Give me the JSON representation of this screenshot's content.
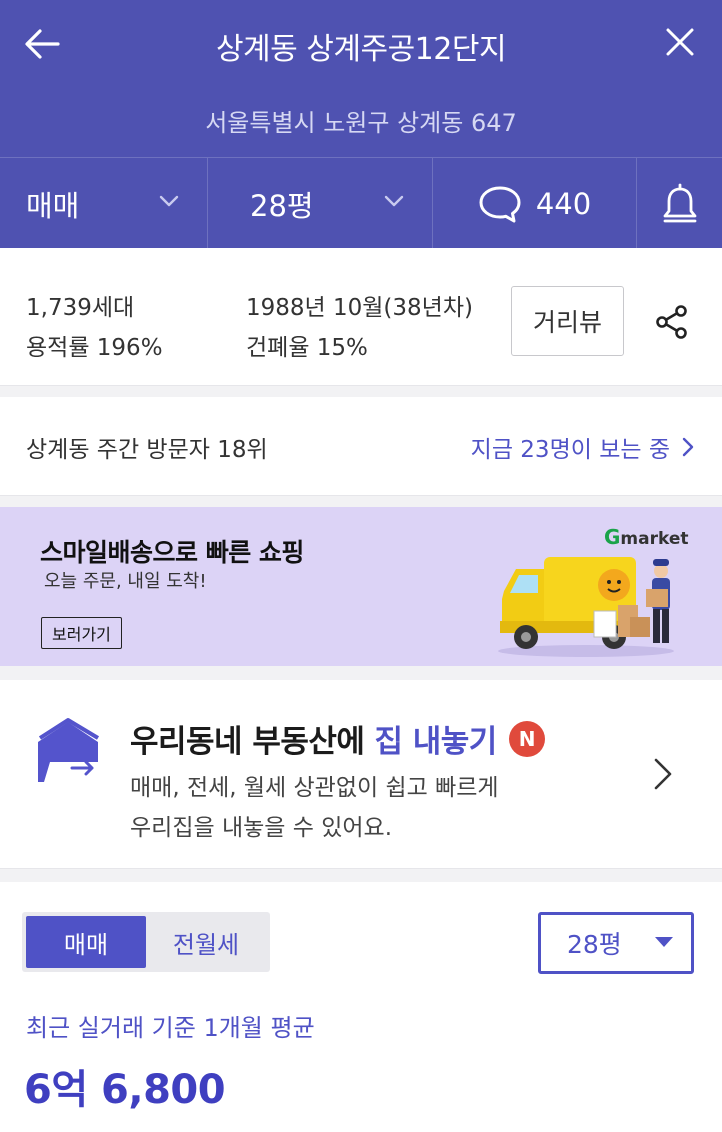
{
  "header": {
    "title": "상계동 상계주공12단지",
    "address": "서울특별시 노원구 상계동 647",
    "back_icon": "back-arrow-icon",
    "close_icon": "close-icon"
  },
  "filters": {
    "deal_type": "매매",
    "size": "28평",
    "comment_count": "440"
  },
  "info": {
    "households": "1,739세대",
    "floor_area_ratio": "용적률 196%",
    "built": "1988년 10월(38년차)",
    "building_coverage": "건폐율 15%",
    "street_view_label": "거리뷰"
  },
  "visitors": {
    "rank_text": "상계동 주간 방문자 18위",
    "watching_text": "지금 23명이 보는 중"
  },
  "ad": {
    "headline": "스마일배송으로 빠른 쇼핑",
    "subtext": "오늘 주문, 내일 도착!",
    "button_label": "보러가기",
    "brand_g": "G",
    "brand_rest": "market"
  },
  "sell": {
    "heading_prefix": "우리동네 부동산에",
    "heading_highlight": "집 내놓기",
    "badge": "N",
    "desc_line1": "매매, 전세, 월세 상관없이 쉽고 빠르게",
    "desc_line2": "우리집을 내놓을 수 있어요."
  },
  "price": {
    "tabs": [
      "매매",
      "전월세"
    ],
    "active_tab": "매매",
    "size_select": "28평",
    "basis_text": "최근 실거래 기준 1개월 평균",
    "average_price": "6억 6,800"
  },
  "colors": {
    "header_bg": "#4f52b1",
    "accent": "#4f52c6",
    "ad_bg": "#dcd3f6",
    "badge_red": "#e04a3c"
  }
}
